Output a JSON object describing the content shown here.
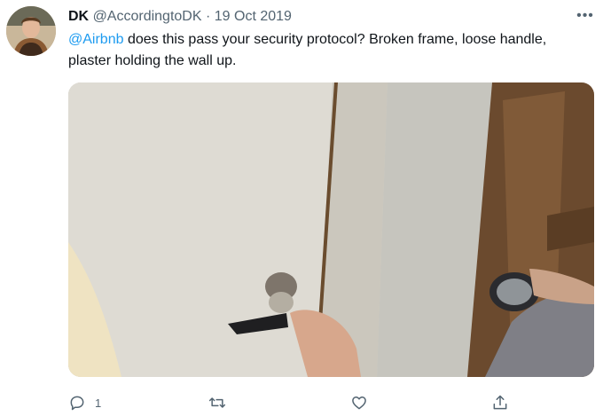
{
  "tweet": {
    "author_name": "DK",
    "handle": "@AccordingtoDK",
    "separator": "·",
    "date": "19 Oct 2019",
    "more_label": "•••",
    "mention": "@Airbnb",
    "body": " does this pass your security protocol? Broken frame, loose handle, plaster holding the wall up.",
    "reply_count": "1"
  },
  "icons": {
    "reply": "reply-icon",
    "retweet": "retweet-icon",
    "like": "heart-icon",
    "share": "share-icon"
  },
  "colors": {
    "text": "#0f1419",
    "secondary": "#536471",
    "link": "#1d9bf0"
  }
}
